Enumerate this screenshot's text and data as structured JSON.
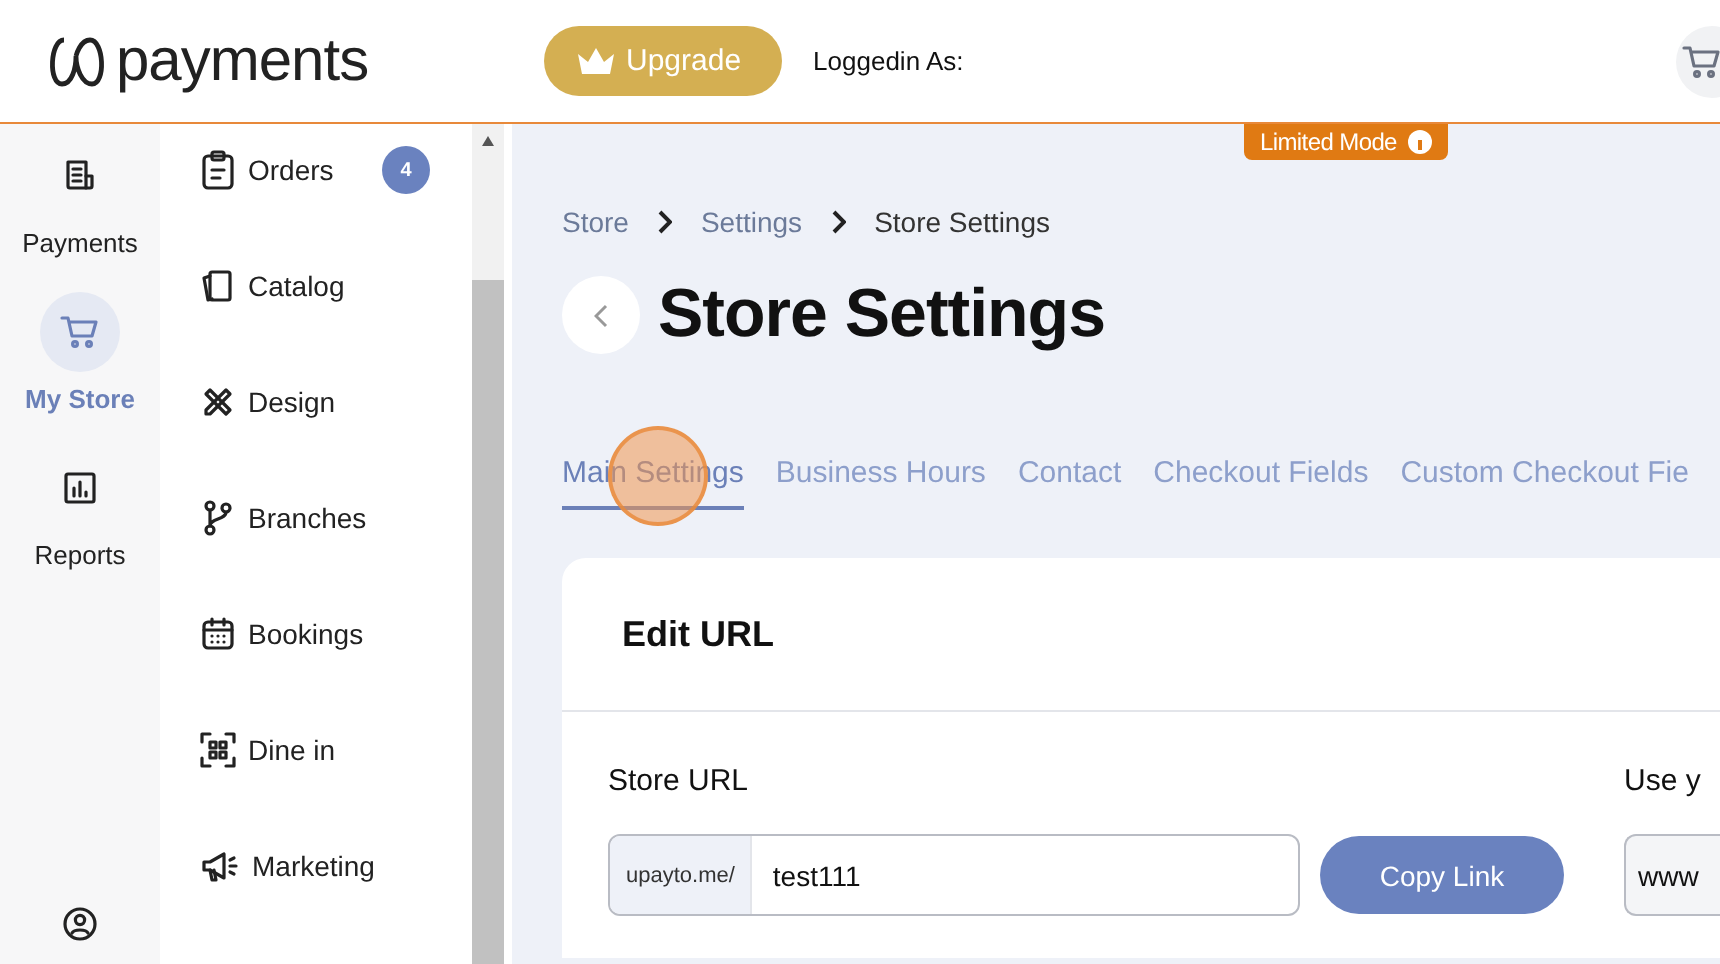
{
  "header": {
    "logo": "payments",
    "upgrade_button": "Upgrade",
    "logged_in_label": "Loggedin As:"
  },
  "rail": [
    {
      "label": "Payments",
      "selected": false
    },
    {
      "label": "My Store",
      "selected": true
    },
    {
      "label": "Reports",
      "selected": false
    }
  ],
  "submenu": [
    {
      "label": "Orders",
      "badge": "4"
    },
    {
      "label": "Catalog"
    },
    {
      "label": "Design"
    },
    {
      "label": "Branches"
    },
    {
      "label": "Bookings"
    },
    {
      "label": "Dine in"
    },
    {
      "label": "Marketing"
    }
  ],
  "limited_mode": "Limited Mode",
  "breadcrumb": [
    "Store",
    "Settings",
    "Store Settings"
  ],
  "page_title": "Store Settings",
  "tabs": [
    {
      "label": "Main Settings",
      "selected": true
    },
    {
      "label": "Business Hours",
      "selected": false
    },
    {
      "label": "Contact",
      "selected": false
    },
    {
      "label": "Checkout Fields",
      "selected": false
    },
    {
      "label": "Custom Checkout Fie",
      "selected": false
    }
  ],
  "card": {
    "title": "Edit URL",
    "store_url": {
      "label": "Store URL",
      "prefix": "upayto.me/",
      "value": "test111",
      "button": "Copy Link"
    },
    "custom_domain": {
      "label": "Use y",
      "value": "www"
    }
  }
}
